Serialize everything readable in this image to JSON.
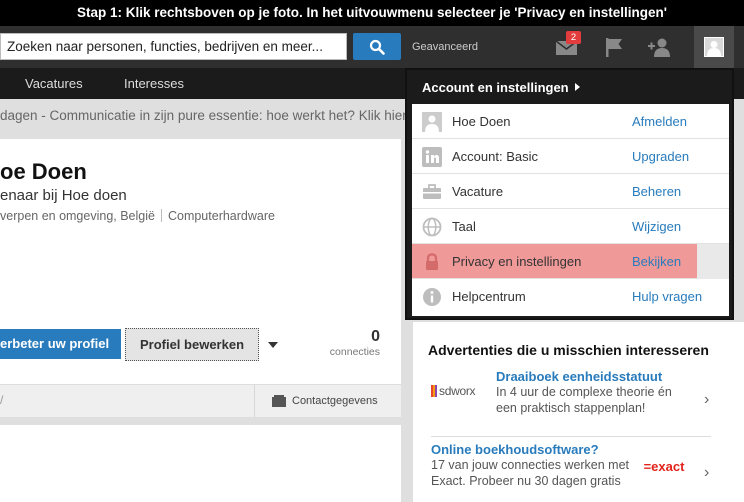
{
  "banner": {
    "text": "Stap 1: Klik rechtsboven op je foto. In het uitvouwmenu selecteer je 'Privacy en instellingen'"
  },
  "search": {
    "value": "Zoeken naar personen, functies, bedrijven en meer...",
    "button_icon": "search-icon"
  },
  "topbar": {
    "advanced_label": "Geavanceerd",
    "messages_badge": "2",
    "icons": [
      "messages-icon",
      "flag-icon",
      "add-connection-icon",
      "avatar"
    ]
  },
  "nav": {
    "items": [
      {
        "label": "Vacatures"
      },
      {
        "label": "Interesses"
      }
    ]
  },
  "ticker": {
    "text": "dagen - Communicatie in zijn pure essentie: hoe werkt het? Klik hier"
  },
  "profile": {
    "name": "oe Doen",
    "headline": "enaar bij Hoe doen",
    "location": "verpen en omgeving, België",
    "industry": "Computerhardware",
    "improve_label": "erbeter uw profiel",
    "edit_label": "Profiel bewerken",
    "connections_count": "0",
    "connections_label": "connecties",
    "footer_left": "/",
    "contact_label": "Contactgegevens"
  },
  "dropdown": {
    "header": "Account en instellingen",
    "items": [
      {
        "label": "Hoe Doen",
        "action": "Afmelden",
        "icon": "user-photo-icon"
      },
      {
        "label": "Account: Basic",
        "action": "Upgraden",
        "icon": "linkedin-icon"
      },
      {
        "label": "Vacature",
        "action": "Beheren",
        "icon": "briefcase-icon"
      },
      {
        "label": "Taal",
        "action": "Wijzigen",
        "icon": "globe-icon"
      },
      {
        "label": "Privacy en instellingen",
        "action": "Bekijken",
        "icon": "lock-icon",
        "highlighted": true
      },
      {
        "label": "Helpcentrum",
        "action": "Hulp vragen",
        "icon": "info-icon"
      }
    ]
  },
  "ads": {
    "title": "Advertenties die u misschien interesseren",
    "items": [
      {
        "title": "Draaiboek eenheidsstatuut",
        "text": "In 4 uur de complexe theorie én een praktisch stappenplan!",
        "logo": "sdworx"
      },
      {
        "title": "Online boekhoudsoftware?",
        "text": "17 van jouw connecties werken met Exact. Probeer nu 30 dagen gratis",
        "logo": "=exact"
      }
    ]
  },
  "colors": {
    "accent": "#287bbc",
    "highlight": "#f09999",
    "topbar": "#2f2f2f",
    "navbar": "#1b1b1b"
  }
}
